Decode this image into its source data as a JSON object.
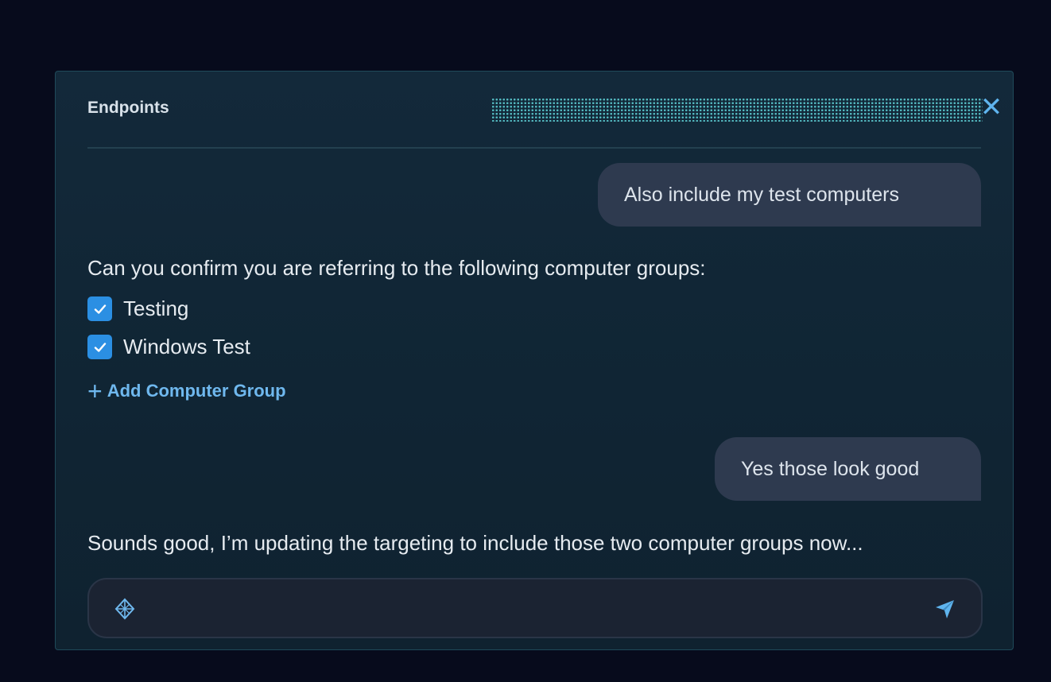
{
  "panel": {
    "title": "Endpoints",
    "close_icon": "close-icon"
  },
  "conversation": {
    "user_message_1": "Also include my test computers",
    "assistant_message_1": "Can you confirm you are referring to the following computer groups:",
    "groups": [
      {
        "label": "Testing",
        "checked": true
      },
      {
        "label": "Windows Test",
        "checked": true
      }
    ],
    "add_group_label": "Add Computer Group",
    "user_message_2": "Yes those look good",
    "assistant_message_2": "Sounds good, I’m updating the targeting to include those two computer groups now..."
  },
  "input": {
    "value": "",
    "leading_icon": "ai-sparkle-icon",
    "send_icon": "send-icon"
  },
  "colors": {
    "background": "#070b1c",
    "panel": "#12283a",
    "accent": "#2b8fe3",
    "link": "#6fb8ee",
    "bubble": "#2e3a4f"
  }
}
